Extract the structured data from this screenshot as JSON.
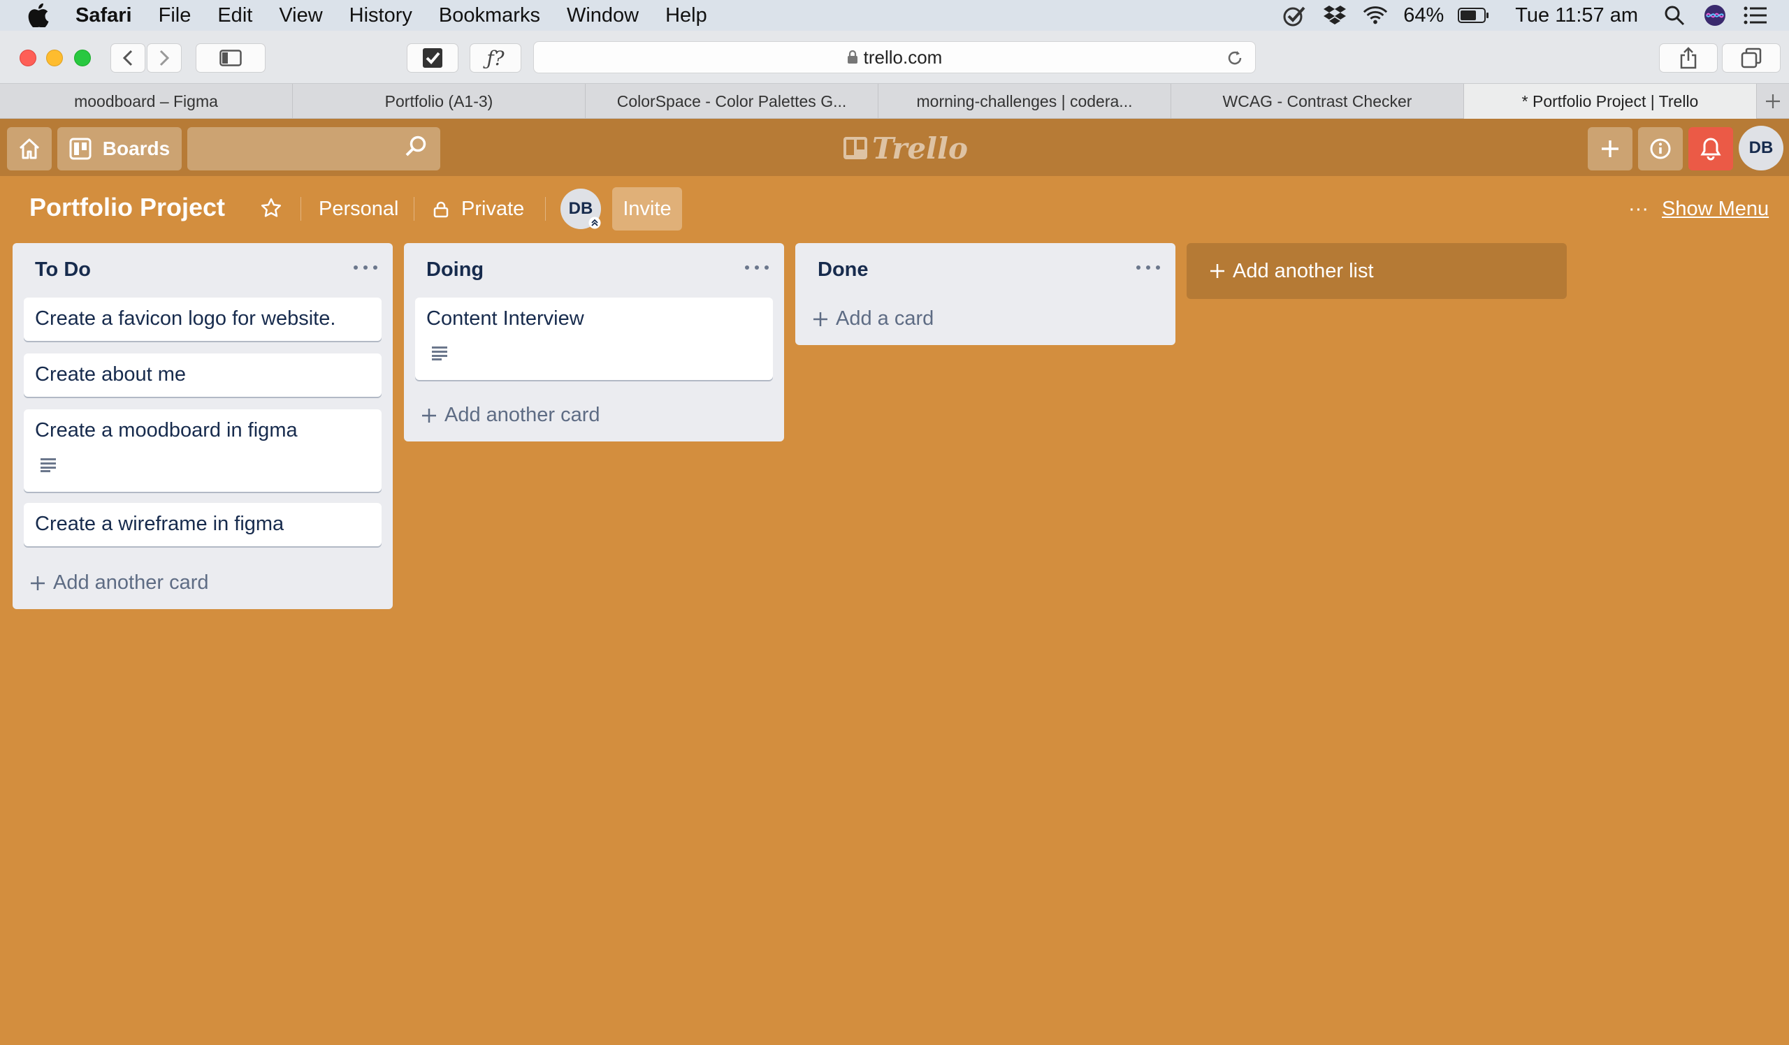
{
  "menubar": {
    "app_name": "Safari",
    "items": [
      "File",
      "Edit",
      "View",
      "History",
      "Bookmarks",
      "Window",
      "Help"
    ],
    "battery": "64%",
    "clock": "Tue 11:57 am"
  },
  "browser": {
    "url": "trello.com",
    "tabs": [
      "moodboard – Figma",
      "Portfolio (A1-3)",
      "ColorSpace - Color Palettes G...",
      "morning-challenges | codera...",
      "WCAG - Contrast Checker",
      "* Portfolio Project | Trello"
    ],
    "active_tab": 5
  },
  "header": {
    "boards_label": "Boards",
    "search_value": "",
    "logo_text": "Trello",
    "user_initials": "DB"
  },
  "board": {
    "title": "Portfolio Project",
    "team": "Personal",
    "visibility": "Private",
    "member_initials": "DB",
    "invite_label": "Invite",
    "show_menu_label": "Show Menu",
    "menu_dots": "···"
  },
  "lists": [
    {
      "title": "To Do",
      "cards": [
        {
          "title": "Create a favicon logo for website."
        },
        {
          "title": "Create about me"
        },
        {
          "title": "Create a moodboard in figma"
        },
        {
          "title": "Create a wireframe in figma"
        }
      ],
      "add_label": "Add another card"
    },
    {
      "title": "Doing",
      "cards": [
        {
          "title": "Content Interview"
        }
      ],
      "add_label": "Add another card"
    },
    {
      "title": "Done",
      "cards": [],
      "add_label": "Add a card"
    }
  ],
  "add_list_label": "Add another list",
  "colors": {
    "board_bg": "#d38e3e",
    "header_bg": "#b77b36",
    "list_bg": "#ebecf0",
    "notification": "#eb5a46"
  }
}
